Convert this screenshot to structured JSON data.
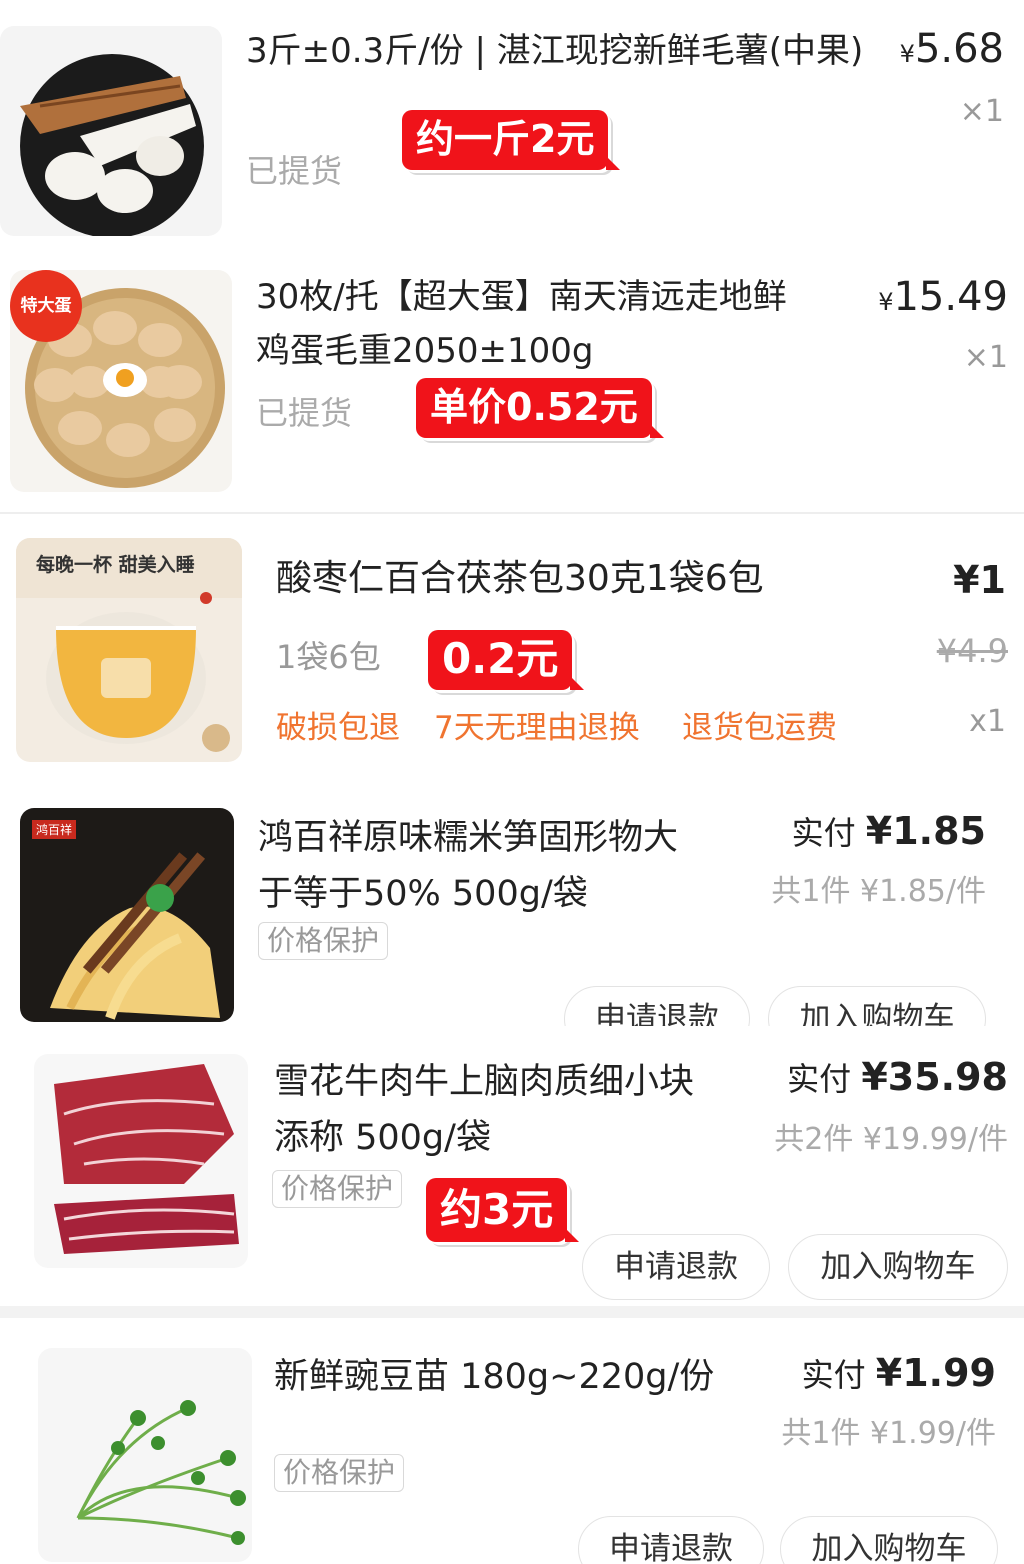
{
  "items": [
    {
      "title": "3斤±0.3斤/份 | 湛江现挖新鲜毛薯(中果)",
      "currency": "¥",
      "price": "5.68",
      "qty": "×1",
      "status": "已提货",
      "sticker": "约一斤2元"
    },
    {
      "badge": "特大蛋",
      "title_line1": "30枚/托【超大蛋】南天清远走地鲜",
      "title_line2": "鸡蛋毛重2050±100g",
      "currency": "¥",
      "price": "15.49",
      "qty": "×1",
      "status": "已提货",
      "sticker": "单价0.52元"
    },
    {
      "image_caption": "每晚一杯 甜美入睡",
      "title": "酸枣仁百合茯茶包30克1袋6包",
      "price": "¥1",
      "original_price": "¥4.9",
      "spec": "1袋6包",
      "sticker": "0.2元",
      "services": [
        "破损包退",
        "7天无理由退换",
        "退货包运费"
      ],
      "qty": "x1"
    },
    {
      "brand_tag": "鸿百祥",
      "title_line1": "鸿百祥原味糯米笋固形物大",
      "title_line2": "于等于50% 500g/袋",
      "tag": "价格保护",
      "paid_label": "实付",
      "paid": "¥1.85",
      "per_unit": "共1件 ¥1.85/件",
      "refund_button": "申请退款",
      "cart_button": "加入购物车"
    },
    {
      "title_line1": "雪花牛肉牛上脑肉质细小块",
      "title_line2": "添称 500g/袋",
      "tag": "价格保护",
      "sticker": "约3元",
      "paid_label": "实付",
      "paid": "¥35.98",
      "per_unit": "共2件 ¥19.99/件",
      "refund_button": "申请退款",
      "cart_button": "加入购物车"
    },
    {
      "title": "新鲜豌豆苗 180g~220g/份",
      "tag": "价格保护",
      "paid_label": "实付",
      "paid": "¥1.99",
      "per_unit": "共1件 ¥1.99/件",
      "refund_button": "申请退款",
      "cart_button": "加入购物车"
    }
  ],
  "colors": {
    "sticker_red": "#f0131a",
    "service_orange": "#f07430",
    "muted_gray": "#aaaaaa"
  }
}
